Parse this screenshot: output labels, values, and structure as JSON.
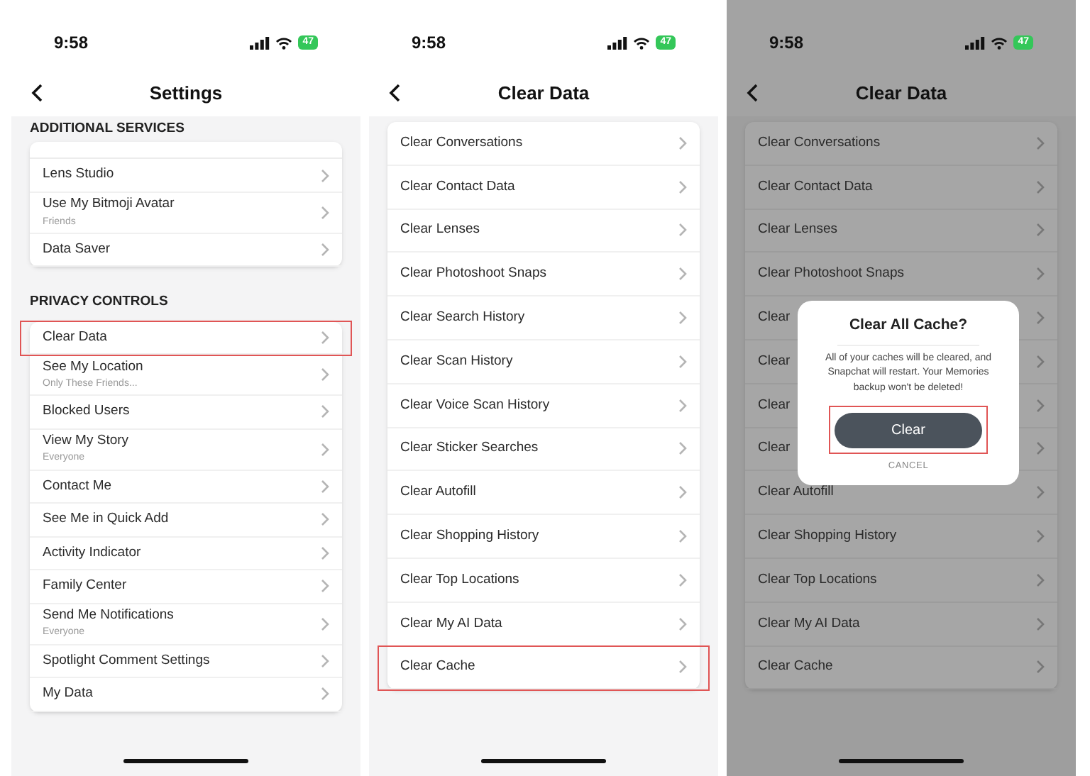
{
  "screens": [
    {
      "time": "9:58",
      "battery": "47",
      "title": "Settings",
      "dimmed": false,
      "sections": [
        {
          "header": "ADDITIONAL SERVICES",
          "cut_top": true,
          "rows": [
            {
              "label": "Lens Studio",
              "highlighted": false
            },
            {
              "label": "Use My Bitmoji Avatar",
              "sublabel": "Friends",
              "highlighted": false
            },
            {
              "label": "Data Saver",
              "highlighted": false
            }
          ]
        },
        {
          "header": "PRIVACY CONTROLS",
          "cut_top": false,
          "rows": [
            {
              "label": "Clear Data",
              "highlighted": true
            },
            {
              "label": "See My Location",
              "sublabel": "Only These Friends...",
              "highlighted": false
            },
            {
              "label": "Blocked Users",
              "highlighted": false
            },
            {
              "label": "View My Story",
              "sublabel": "Everyone",
              "highlighted": false
            },
            {
              "label": "Contact Me",
              "highlighted": false
            },
            {
              "label": "See Me in Quick Add",
              "highlighted": false
            },
            {
              "label": "Activity Indicator",
              "highlighted": false
            },
            {
              "label": "Family Center",
              "highlighted": false
            },
            {
              "label": "Send Me Notifications",
              "sublabel": "Everyone",
              "highlighted": false
            },
            {
              "label": "Spotlight Comment Settings",
              "highlighted": false
            },
            {
              "label": "My Data",
              "highlighted": false
            }
          ]
        }
      ]
    },
    {
      "time": "9:58",
      "battery": "47",
      "title": "Clear Data",
      "dimmed": false,
      "sections": [
        {
          "cut_top": false,
          "rows": [
            {
              "label": "Clear Conversations",
              "highlighted": false
            },
            {
              "label": "Clear Contact Data",
              "highlighted": false
            },
            {
              "label": "Clear Lenses",
              "highlighted": false
            },
            {
              "label": "Clear Photoshoot Snaps",
              "highlighted": false
            },
            {
              "label": "Clear Search History",
              "highlighted": false
            },
            {
              "label": "Clear Scan History",
              "highlighted": false
            },
            {
              "label": "Clear Voice Scan History",
              "highlighted": false
            },
            {
              "label": "Clear Sticker Searches",
              "highlighted": false
            },
            {
              "label": "Clear Autofill",
              "highlighted": false
            },
            {
              "label": "Clear Shopping History",
              "highlighted": false
            },
            {
              "label": "Clear Top Locations",
              "highlighted": false
            },
            {
              "label": "Clear My AI Data",
              "highlighted": false
            },
            {
              "label": "Clear Cache",
              "highlighted": true
            }
          ]
        }
      ]
    },
    {
      "time": "9:58",
      "battery": "47",
      "title": "Clear Data",
      "dimmed": true,
      "sections": [
        {
          "cut_top": false,
          "rows": [
            {
              "label": "Clear Conversations",
              "highlighted": false
            },
            {
              "label": "Clear Contact Data",
              "highlighted": false
            },
            {
              "label": "Clear Lenses",
              "highlighted": false
            },
            {
              "label": "Clear Photoshoot Snaps",
              "highlighted": false
            },
            {
              "label": "Clear",
              "highlighted": false
            },
            {
              "label": "Clear",
              "highlighted": false
            },
            {
              "label": "Clear",
              "highlighted": false
            },
            {
              "label": "Clear",
              "highlighted": false
            },
            {
              "label": "Clear Autofill",
              "highlighted": false
            },
            {
              "label": "Clear Shopping History",
              "highlighted": false
            },
            {
              "label": "Clear Top Locations",
              "highlighted": false
            },
            {
              "label": "Clear My AI Data",
              "highlighted": false
            },
            {
              "label": "Clear Cache",
              "highlighted": false
            }
          ]
        }
      ],
      "dialog": {
        "title": "Clear All Cache?",
        "message": "All of your caches will be cleared, and Snapchat will restart. Your Memories backup won't be deleted!",
        "confirm": {
          "label": "Clear",
          "highlighted": true
        },
        "cancel": "CANCEL"
      }
    }
  ]
}
